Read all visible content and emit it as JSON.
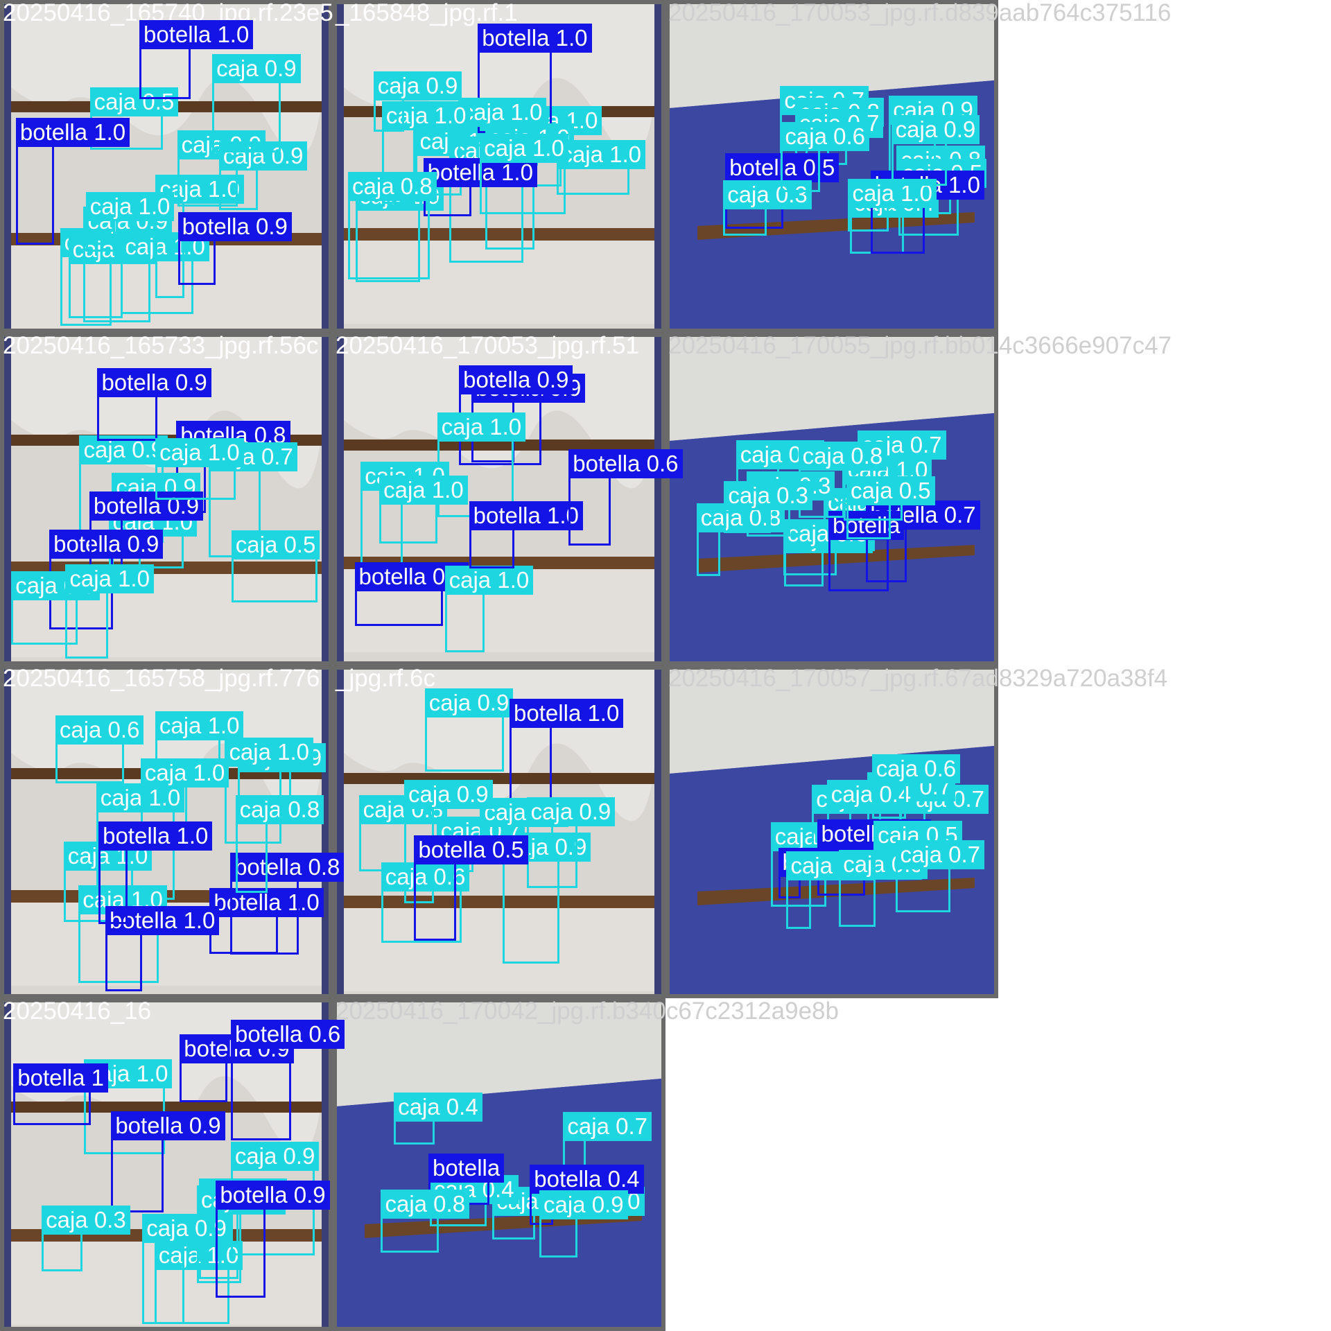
{
  "mosaic": {
    "tiles": [
      {
        "name": "20250416_165740_jpg.rf.23e5",
        "variant": "shelf",
        "detections": [
          {
            "cls": "caja",
            "label": "caja 0.9"
          },
          {
            "cls": "caja",
            "label": "caja 1.0"
          },
          {
            "cls": "caja",
            "label": "caja 1.0"
          },
          {
            "cls": "caja",
            "label": "caja 1.0"
          },
          {
            "cls": "botella",
            "label": "botella 0.9"
          },
          {
            "cls": "caja",
            "label": "caja 0.9"
          },
          {
            "cls": "caja",
            "label": "caja 0.5"
          },
          {
            "cls": "caja",
            "label": "caja 0.9"
          },
          {
            "cls": "botella",
            "label": "botella 1.0"
          },
          {
            "cls": "botella",
            "label": "botella 1.0"
          },
          {
            "cls": "caja",
            "label": "caja 0.9"
          },
          {
            "cls": "caja",
            "label": "caja 0.9"
          },
          {
            "cls": "caja",
            "label": "caja 1.0"
          }
        ]
      },
      {
        "name": "_165848_jpg.rf.1",
        "variant": "shelf",
        "detections": [
          {
            "cls": "caja",
            "label": "caja 1.0"
          },
          {
            "cls": "caja",
            "label": "caja 1.0"
          },
          {
            "cls": "caja",
            "label": "caja 1.0"
          },
          {
            "cls": "caja",
            "label": "caja 1.0"
          },
          {
            "cls": "botella",
            "label": "botella 1.0"
          },
          {
            "cls": "caja",
            "label": "caja 1.0"
          },
          {
            "cls": "caja",
            "label": "caja 1.0"
          },
          {
            "cls": "caja",
            "label": "caja 1.0"
          },
          {
            "cls": "caja",
            "label": "caja 1.0"
          },
          {
            "cls": "botella",
            "label": "botella 1.0"
          },
          {
            "cls": "caja",
            "label": "caja 0.8"
          },
          {
            "cls": "caja",
            "label": "caja 0.9"
          },
          {
            "cls": "caja",
            "label": "caja 1.0"
          }
        ]
      },
      {
        "name": "20250416_170053_jpg.rf.d839aab764c375116",
        "variant": "room",
        "detections": [
          {
            "cls": "caja",
            "label": "caja 0.8"
          },
          {
            "cls": "caja",
            "label": "caja 0.7"
          },
          {
            "cls": "caja",
            "label": "caja 0.8"
          },
          {
            "cls": "caja",
            "label": "caja 0.9"
          },
          {
            "cls": "caja",
            "label": "caja 0.7"
          },
          {
            "cls": "caja",
            "label": "caja 0.4"
          },
          {
            "cls": "caja",
            "label": "caja 0.5"
          },
          {
            "cls": "botella",
            "label": "botella 0.5"
          },
          {
            "cls": "botella",
            "label": "botella 1.0"
          },
          {
            "cls": "caja",
            "label": "caja 1.0"
          },
          {
            "cls": "caja",
            "label": "caja 0.3"
          },
          {
            "cls": "caja",
            "label": "caja 0.6"
          },
          {
            "cls": "caja",
            "label": "caja 0.9"
          }
        ]
      },
      {
        "name": "20250416_165733_jpg.rf.56c",
        "variant": "shelf",
        "detections": [
          {
            "cls": "botella",
            "label": "botella 0.8"
          },
          {
            "cls": "caja",
            "label": "caja 0.9"
          },
          {
            "cls": "caja",
            "label": "caja 1.0"
          },
          {
            "cls": "caja",
            "label": "caja 0.5"
          },
          {
            "cls": "caja",
            "label": "caja 0.9"
          },
          {
            "cls": "caja",
            "label": "caja 0.7"
          },
          {
            "cls": "botella",
            "label": "botella 0.9"
          },
          {
            "cls": "botella",
            "label": "botella 0.9"
          },
          {
            "cls": "botella",
            "label": "botella 0.9"
          },
          {
            "cls": "caja",
            "label": "caja 0.9"
          },
          {
            "cls": "caja",
            "label": "caja 1.0"
          },
          {
            "cls": "caja",
            "label": "caja 1.0"
          }
        ]
      },
      {
        "name": "20250416_170053_jpg.rf.51",
        "variant": "shelf",
        "detections": [
          {
            "cls": "botella",
            "label": "botella 0.9"
          },
          {
            "cls": "botella",
            "label": "botella 0.9"
          },
          {
            "cls": "caja",
            "label": "caja 1.0"
          },
          {
            "cls": "caja",
            "label": "caja 1.0"
          },
          {
            "cls": "caja",
            "label": "caja 1.0"
          },
          {
            "cls": "botella",
            "label": "botella 0.9"
          },
          {
            "cls": "caja",
            "label": "caja 1.0"
          },
          {
            "cls": "botella",
            "label": "botella 1.0"
          },
          {
            "cls": "botella",
            "label": "botella 0.6"
          }
        ]
      },
      {
        "name": "20250416_170055_jpg.rf.bb014c3666e907c47",
        "variant": "room",
        "detections": [
          {
            "cls": "caja",
            "label": "caja 0.7"
          },
          {
            "cls": "caja",
            "label": "caja 0.4"
          },
          {
            "cls": "caja",
            "label": "caja 0.6"
          },
          {
            "cls": "caja",
            "label": "caja 0.9"
          },
          {
            "cls": "caja",
            "label": "caja 0.8"
          },
          {
            "cls": "caja",
            "label": "caja 0.3"
          },
          {
            "cls": "caja",
            "label": "caja 0.7"
          },
          {
            "cls": "botella",
            "label": "botella 0.7"
          },
          {
            "cls": "botella",
            "label": "botella"
          },
          {
            "cls": "caja",
            "label": "caja 1.0"
          },
          {
            "cls": "caja",
            "label": "caja 0.8"
          },
          {
            "cls": "caja",
            "label": "caja 0.3"
          },
          {
            "cls": "caja",
            "label": "caja 0.5"
          }
        ]
      },
      {
        "name": "20250416_165758_jpg.rf.776",
        "variant": "shelf",
        "detections": [
          {
            "cls": "caja",
            "label": "caja 1.0"
          },
          {
            "cls": "caja",
            "label": "caja 1.0"
          },
          {
            "cls": "caja",
            "label": "caja 1.0"
          },
          {
            "cls": "caja",
            "label": "caja 1.0"
          },
          {
            "cls": "botella",
            "label": "botella 1.0"
          },
          {
            "cls": "botella",
            "label": "botella 1.0"
          },
          {
            "cls": "caja",
            "label": "caja 0.9"
          },
          {
            "cls": "botella",
            "label": "botella 0.8"
          },
          {
            "cls": "caja",
            "label": "caja 0.6"
          },
          {
            "cls": "caja",
            "label": "caja 0.8"
          },
          {
            "cls": "caja",
            "label": "caja 1.0"
          },
          {
            "cls": "botella",
            "label": "botella 1.0"
          },
          {
            "cls": "caja",
            "label": "caja 1.0"
          }
        ]
      },
      {
        "name": "_jpg.rf.6c",
        "variant": "shelf",
        "detections": [
          {
            "cls": "caja",
            "label": "caja 0.8"
          },
          {
            "cls": "caja",
            "label": "caja 0.9"
          },
          {
            "cls": "caja",
            "label": "caja 0.9"
          },
          {
            "cls": "caja",
            "label": "caja 0.7"
          },
          {
            "cls": "botella",
            "label": "botella 1.0"
          },
          {
            "cls": "caja",
            "label": "caja 1.0"
          },
          {
            "cls": "caja",
            "label": "caja 0.9"
          },
          {
            "cls": "caja",
            "label": "caja 0.6"
          },
          {
            "cls": "caja",
            "label": "caja 0.9"
          },
          {
            "cls": "botella",
            "label": "botella 0.5"
          }
        ]
      },
      {
        "name": "20250416_170057_jpg.rf.67ad8329a720a38f4",
        "variant": "room",
        "detections": [
          {
            "cls": "caja",
            "label": "caja 0.7"
          },
          {
            "cls": "caja",
            "label": "caja 0.7"
          },
          {
            "cls": "caja",
            "label": "caja 0.9"
          },
          {
            "cls": "caja",
            "label": "caja 0.7"
          },
          {
            "cls": "caja",
            "label": "caja 0.4"
          },
          {
            "cls": "caja",
            "label": "caja 0.6"
          },
          {
            "cls": "botella",
            "label": "botella 0.6"
          },
          {
            "cls": "botella",
            "label": "botella 1.0"
          },
          {
            "cls": "caja",
            "label": "caja 1.0"
          },
          {
            "cls": "caja",
            "label": "caja 0.9"
          },
          {
            "cls": "caja",
            "label": "caja 0.5"
          },
          {
            "cls": "caja",
            "label": "caja 0.7"
          }
        ]
      },
      {
        "name": "20250416_16",
        "variant": "shelf",
        "detections": [
          {
            "cls": "botella",
            "label": "botella 0.9"
          },
          {
            "cls": "caja",
            "label": "caja 1.0"
          },
          {
            "cls": "caja",
            "label": "caja 1.0"
          },
          {
            "cls": "caja",
            "label": "caja 1.0"
          },
          {
            "cls": "botella",
            "label": "botella 0.9"
          },
          {
            "cls": "caja",
            "label": "caja 0.9"
          },
          {
            "cls": "caja",
            "label": "caja 0.7"
          },
          {
            "cls": "caja",
            "label": "caja 0.9"
          },
          {
            "cls": "botella",
            "label": "botella 1"
          },
          {
            "cls": "botella",
            "label": "botella 0.6"
          },
          {
            "cls": "botella",
            "label": "botella 0.9"
          },
          {
            "cls": "caja",
            "label": "caja 0.3"
          }
        ]
      },
      {
        "name": "20250416_170042_jpg.rf.b340c67c2312a9e8b",
        "variant": "room",
        "detections": [
          {
            "cls": "caja",
            "label": "caja 0.70.81.0"
          },
          {
            "cls": "caja",
            "label": "caja 0.7"
          },
          {
            "cls": "caja",
            "label": "caja 0.4"
          },
          {
            "cls": "botella",
            "label": "botella 0.4"
          },
          {
            "cls": "botella",
            "label": "botella"
          },
          {
            "cls": "caja",
            "label": "caja 0.4"
          },
          {
            "cls": "caja",
            "label": "caja 0.8"
          },
          {
            "cls": "caja",
            "label": "caja 0.9"
          }
        ]
      }
    ]
  }
}
